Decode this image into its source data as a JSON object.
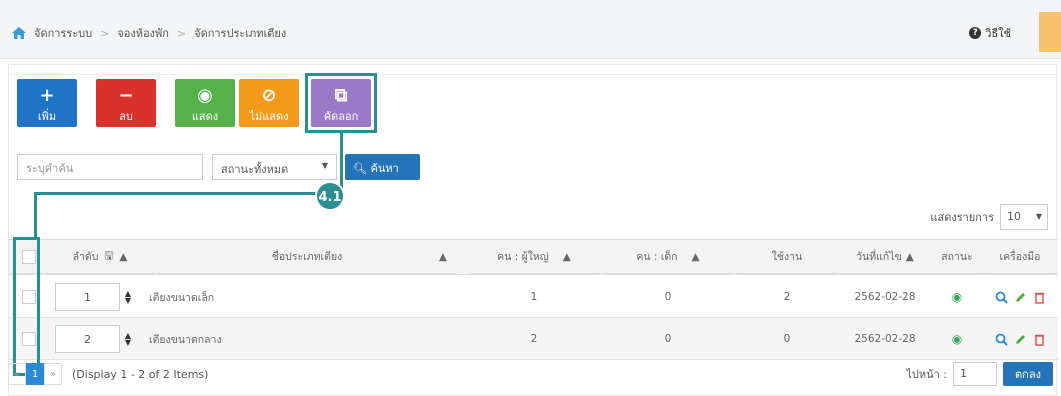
{
  "breadcrumb": [
    "จัดการระบบ",
    "จองห้องพัก",
    "จัดการประเภทเตียง"
  ],
  "help_label": "วิธีใช้",
  "toolbar": {
    "add": "เพิ่ม",
    "delete": "ลบ",
    "show": "แสดง",
    "hide": "ไม่แสดง",
    "copy": "คัดลอก"
  },
  "callout": "4.1",
  "search": {
    "placeholder": "ระบุคำค้น",
    "status_value": "สถานะทั้งหมด",
    "button": "ค้นหา"
  },
  "page_size": {
    "label": "แสดงรายการ",
    "value": "10"
  },
  "table": {
    "headers": [
      "ลำดับ",
      "ชื่อประเภทเตียง",
      "คน : ผู้ใหญ่",
      "คน : เด็ก",
      "ใช้งาน",
      "วันที่แก้ไข",
      "สถานะ",
      "เครื่องมือ"
    ],
    "rows": [
      {
        "order": "1",
        "name": "เตียงขนาดเล็ก",
        "adult": "1",
        "child": "0",
        "used": "2",
        "date": "2562-02-28"
      },
      {
        "order": "2",
        "name": "เตียงขนาดกลาง",
        "adult": "2",
        "child": "0",
        "used": "0",
        "date": "2562-02-28"
      }
    ]
  },
  "pagination": {
    "prev": "«",
    "page": "1",
    "next": "»",
    "info": "(Display 1 - 2 of 2 Items)",
    "goto_label": "ไปหน้า :",
    "goto_value": "1",
    "goto_button": "ตกลง"
  },
  "colors": {
    "add": "#1f74c6",
    "delete": "#d9322c",
    "show": "#56b14a",
    "hide": "#f39a1b",
    "copy": "#9b79c6",
    "highlight": "#2a8e92"
  }
}
